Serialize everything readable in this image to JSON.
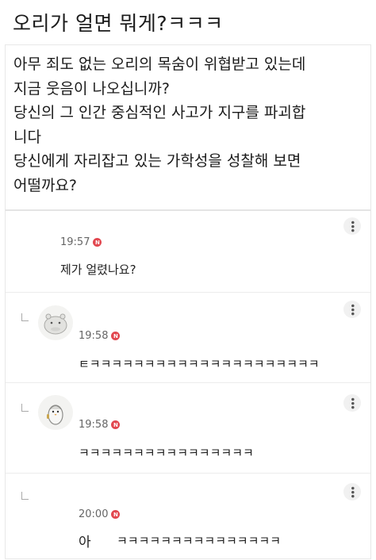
{
  "title": "오리가 얼면 뭐게?ㅋㅋㅋ",
  "post": {
    "lines": [
      "아무 죄도 없는 오리의 목숨이 위협받고 있는데",
      "지금 웃음이 나오십니까?",
      "당신의 그 인간 중심적인 사고가 지구를 파괴합",
      "니다",
      "당신에게 자리잡고 있는 가학성을 성찰해 보면",
      "어떨까요?"
    ]
  },
  "comments": [
    {
      "time": "19:57",
      "badge": "N",
      "text": "제가 얼렸나요?"
    },
    {
      "time": "19:58",
      "badge": "N",
      "text": "ㅌㅋㅋㅋㅋㅋㅋㅋㅋㅋㅋㅋㅋㅋㅋㅋㅋㅋㅋㅋㅋㅋ"
    },
    {
      "time": "19:58",
      "badge": "N",
      "text": "ㅋㅋㅋㅋㅋㅋㅋㅋㅋㅋㅋㅋㅋㅋㅋㅋ"
    },
    {
      "time": "20:00",
      "badge": "N",
      "text_prefix": "아",
      "text": "ㅋㅋㅋㅋㅋㅋㅋㅋㅋㅋㅋㅋㅋㅋㅋ"
    }
  ]
}
